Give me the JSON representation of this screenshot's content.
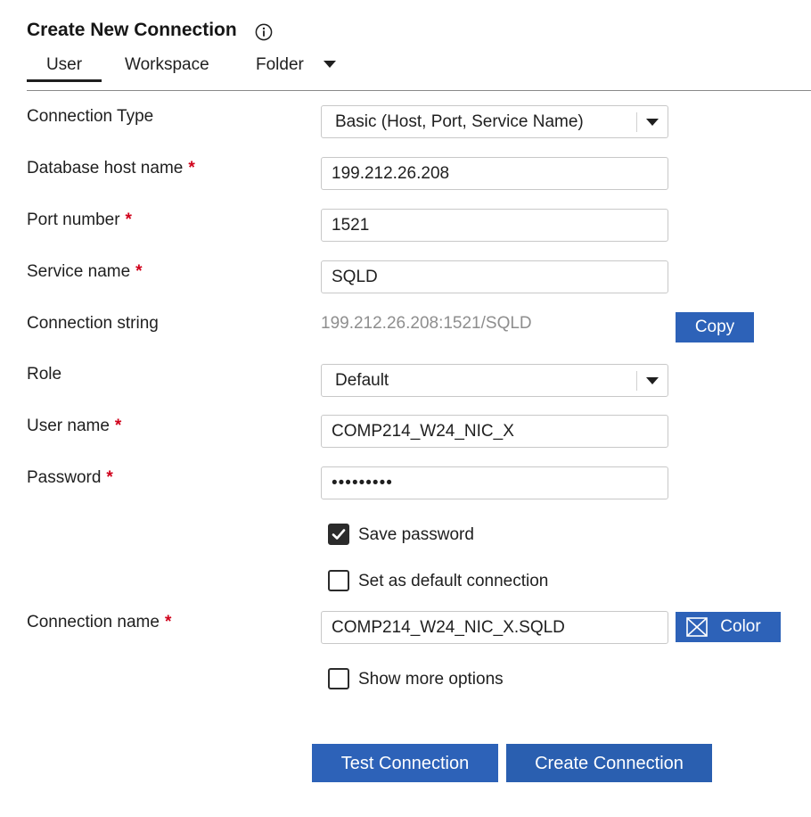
{
  "header": {
    "title": "Create New Connection",
    "info_icon": "info-circle-icon"
  },
  "tabs": [
    {
      "label": "User",
      "active": true
    },
    {
      "label": "Workspace",
      "active": false
    },
    {
      "label": "Folder",
      "active": false
    }
  ],
  "tabs_dropdown_icon": "caret-down-icon",
  "form": {
    "required_mark": "*",
    "connection_type": {
      "label": "Connection Type",
      "value": "Basic (Host, Port, Service Name)"
    },
    "host": {
      "label": "Database host name",
      "value": "199.212.26.208"
    },
    "port": {
      "label": "Port number",
      "value": "1521"
    },
    "service": {
      "label": "Service name",
      "value": "SQLD"
    },
    "connection_string": {
      "label": "Connection string",
      "value": "199.212.26.208:1521/SQLD",
      "copy_label": "Copy"
    },
    "role": {
      "label": "Role",
      "value": "Default"
    },
    "username": {
      "label": "User name",
      "value": "COMP214_W24_NIC_X"
    },
    "password": {
      "label": "Password",
      "value": "•••••••••"
    },
    "save_password": {
      "label": "Save password",
      "checked": true
    },
    "default_connection": {
      "label": "Set as default connection",
      "checked": false
    },
    "connection_name": {
      "label": "Connection name",
      "value": "COMP214_W24_NIC_X.SQLD",
      "color_label": "Color"
    },
    "more_options": {
      "label": "Show more options",
      "checked": false
    }
  },
  "actions": {
    "test_label": "Test Connection",
    "create_label": "Create Connection"
  },
  "colors": {
    "primary": "#2d62b8",
    "required": "#d0021b",
    "muted_text": "#8e8e8e"
  }
}
